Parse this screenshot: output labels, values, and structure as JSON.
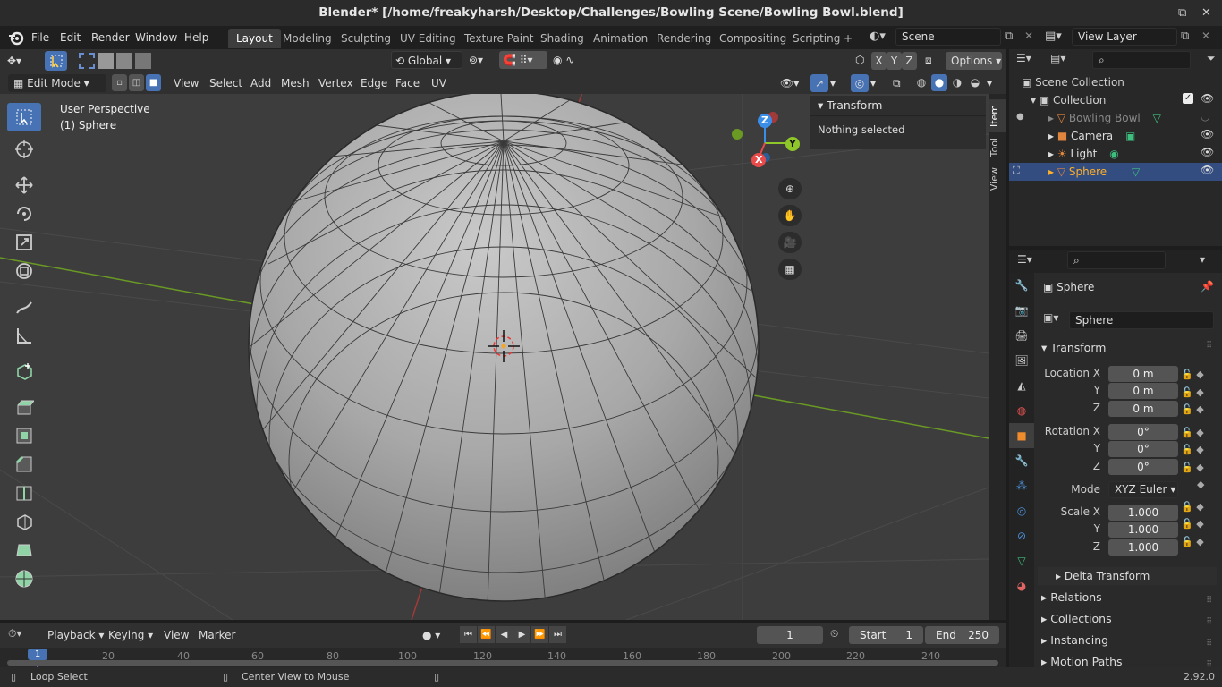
{
  "window": {
    "title": "Blender* [/home/freakyharsh/Desktop/Challenges/Bowling Scene/Bowling Bowl.blend]",
    "minimize": "—",
    "maximize": "⧉",
    "close": "✕"
  },
  "menus": [
    "File",
    "Edit",
    "Render",
    "Window",
    "Help"
  ],
  "workspaces": [
    "Layout",
    "Modeling",
    "Sculpting",
    "UV Editing",
    "Texture Paint",
    "Shading",
    "Animation",
    "Rendering",
    "Compositing",
    "Scripting",
    "+"
  ],
  "scene": {
    "name": "Scene",
    "view_layer": "View Layer"
  },
  "viewport_header": {
    "orientation": "Global",
    "mode": "Edit Mode",
    "options": "Options",
    "menus": [
      "View",
      "Select",
      "Add",
      "Mesh",
      "Vertex",
      "Edge",
      "Face",
      "UV"
    ],
    "axes": [
      "X",
      "Y",
      "Z"
    ]
  },
  "viewport": {
    "perspective": "User Perspective",
    "object_label": "(1) Sphere",
    "gizmo": {
      "x": "X",
      "y": "Y",
      "z": "Z"
    }
  },
  "n_panel": {
    "section": "Transform",
    "message": "Nothing selected",
    "tabs": [
      "Item",
      "Tool",
      "View"
    ]
  },
  "outliner": {
    "root": "Scene Collection",
    "collection": "Collection",
    "items": [
      {
        "name": "Bowling Bowl",
        "icon": "mesh-icon",
        "selected": false,
        "dim": true
      },
      {
        "name": "Camera",
        "icon": "camera-icon",
        "selected": false,
        "dim": false
      },
      {
        "name": "Light",
        "icon": "light-icon",
        "selected": false,
        "dim": false
      },
      {
        "name": "Sphere",
        "icon": "mesh-icon",
        "selected": true,
        "dim": false
      }
    ]
  },
  "properties": {
    "object_name": "Sphere",
    "data_name": "Sphere",
    "transform_title": "Transform",
    "location_label": "Location X",
    "rotation_label": "Rotation X",
    "scale_label": "Scale X",
    "y_label": "Y",
    "z_label": "Z",
    "location": [
      "0 m",
      "0 m",
      "0 m"
    ],
    "rotation": [
      "0°",
      "0°",
      "0°"
    ],
    "mode_label": "Mode",
    "mode_value": "XYZ Euler",
    "scale": [
      "1.000",
      "1.000",
      "1.000"
    ],
    "delta": "Delta Transform",
    "subsections": [
      "Relations",
      "Collections",
      "Instancing",
      "Motion Paths"
    ]
  },
  "timeline": {
    "menus": [
      "Playback",
      "Keying",
      "View",
      "Marker"
    ],
    "current_frame": "1",
    "start_label": "Start",
    "start": "1",
    "end_label": "End",
    "end": "250",
    "ruler": [
      "1",
      "20",
      "40",
      "60",
      "80",
      "100",
      "120",
      "140",
      "160",
      "180",
      "200",
      "220",
      "240"
    ]
  },
  "status": {
    "left": "Loop Select",
    "middle": "Center View to Mouse",
    "version": "2.92.0"
  },
  "colors": {
    "accent": "#4772b3",
    "selected_text": "#ffaf29",
    "x_axis": "#e94a4a",
    "y_axis": "#8fc72a",
    "z_axis": "#3b8ee8"
  }
}
